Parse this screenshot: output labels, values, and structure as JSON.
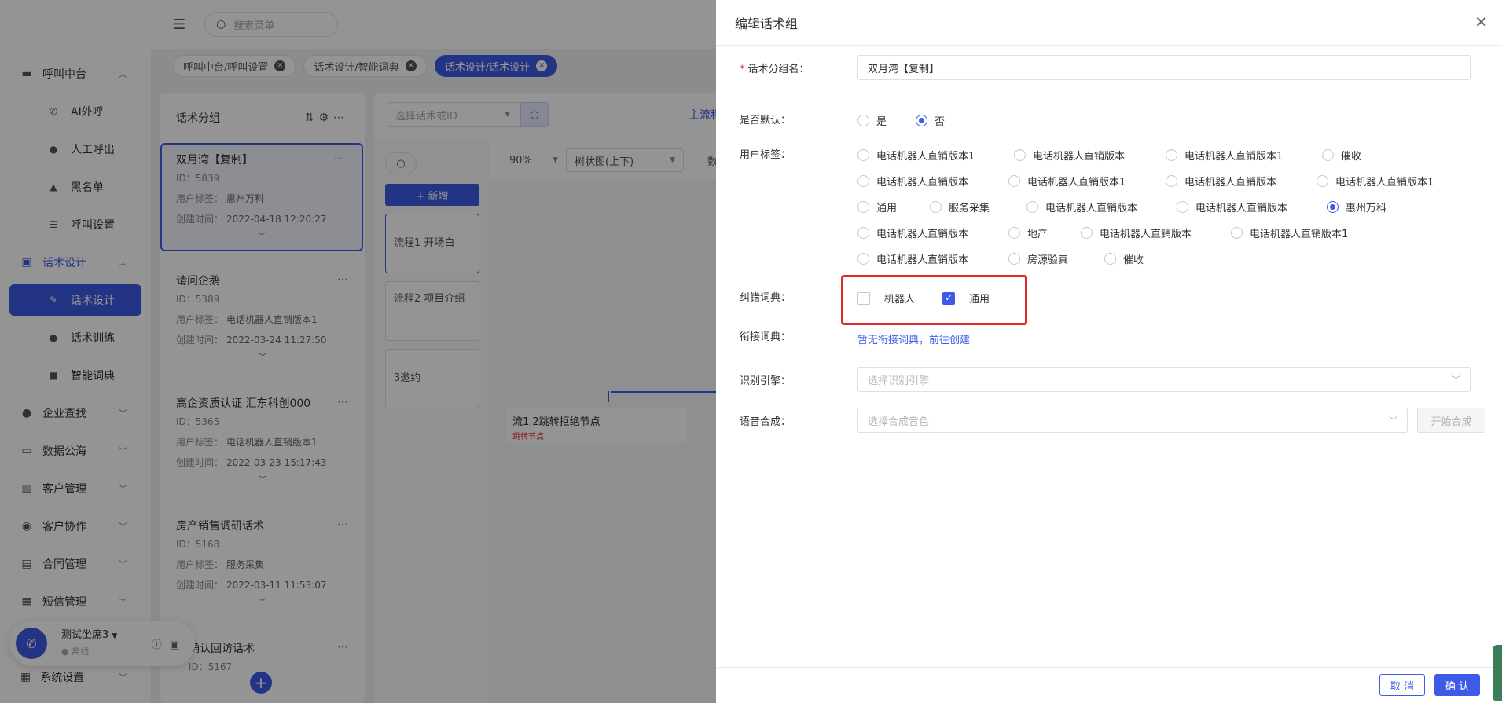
{
  "sidebar": {
    "groups": [
      {
        "label": "呼叫中台",
        "icon": "monitor-icon",
        "expanded": true,
        "items": [
          {
            "label": "AI外呼",
            "icon": "phone-icon"
          },
          {
            "label": "人工呼出",
            "icon": "user-icon"
          },
          {
            "label": "黑名单",
            "icon": "warning-icon"
          },
          {
            "label": "呼叫设置",
            "icon": "sliders-icon"
          }
        ]
      },
      {
        "label": "话术设计",
        "icon": "script-icon",
        "expanded": true,
        "active": true,
        "items": [
          {
            "label": "话术设计",
            "icon": "pen-icon",
            "active": true
          },
          {
            "label": "话术训练",
            "icon": "chat-icon"
          },
          {
            "label": "智能词典",
            "icon": "book-icon"
          }
        ]
      },
      {
        "label": "企业查找",
        "icon": "bulb-icon"
      },
      {
        "label": "数据公海",
        "icon": "chart-icon"
      },
      {
        "label": "客户管理",
        "icon": "customer-icon"
      },
      {
        "label": "客户协作",
        "icon": "collab-icon"
      },
      {
        "label": "合同管理",
        "icon": "clipboard-icon"
      },
      {
        "label": "短信管理",
        "icon": "sms-icon"
      }
    ],
    "system_settings": "系统设置"
  },
  "topbar": {
    "search_placeholder": "搜索菜单"
  },
  "tabs": [
    {
      "label": "呼叫中台/呼叫设置",
      "active": false
    },
    {
      "label": "话术设计/智能词典",
      "active": false
    },
    {
      "label": "话术设计/话术设计",
      "active": true
    }
  ],
  "group_panel": {
    "title": "话术分组",
    "tag_label": "用户标签：",
    "time_label": "创建时间：",
    "cards": [
      {
        "name": "双月湾【复制】",
        "id": "ID：5839",
        "tag": "惠州万科",
        "time": "2022-04-18 12:20:27",
        "selected": true
      },
      {
        "name": "请问企鹅",
        "id": "ID：5389",
        "tag": "电话机器人直销版本1",
        "time": "2022-03-24 11:27:50"
      },
      {
        "name": "高企资质认证 汇东科创000",
        "id": "ID：5365",
        "tag": "电话机器人直销版本1",
        "time": "2022-03-23 15:17:43"
      },
      {
        "name": "房产销售调研话术",
        "id": "ID：5168",
        "tag": "服务采集",
        "time": "2022-03-11 11:53:07"
      },
      {
        "name": "确认回访话术",
        "id": "ID：5167"
      }
    ]
  },
  "flow": {
    "search_placeholder": "选择话术或ID",
    "main_tab": "主流程",
    "new_button": "+ 新增",
    "items": [
      "流程1 开场白",
      "流程2 项目介绍",
      "3邀约"
    ],
    "zoom": "90%",
    "layout": "树状图(上下)",
    "toolbar_extra": "数",
    "node_title": "流1.2跳转拒绝节点",
    "node_sub": "跳转节点"
  },
  "call_widget": {
    "agent": "测试坐席3",
    "status": "离线"
  },
  "drawer": {
    "title": "编辑话术组",
    "fields": {
      "group_name": {
        "label": "话术分组名：",
        "value": "双月湾【复制】"
      },
      "is_default": {
        "label": "是否默认：",
        "options": [
          "是",
          "否"
        ],
        "selected": "否"
      },
      "user_tags": {
        "label": "用户标签：",
        "options": [
          "电话机器人直销版本1",
          "电话机器人直销版本",
          "电话机器人直销版本1",
          "催收",
          "电话机器人直销版本",
          "电话机器人直销版本1",
          "电话机器人直销版本",
          "电话机器人直销版本1",
          "通用",
          "服务采集",
          "电话机器人直销版本",
          "电话机器人直销版本",
          "惠州万科",
          "电话机器人直销版本",
          "地产",
          "电话机器人直销版本",
          "电话机器人直销版本1",
          "电话机器人直销版本",
          "房源验真",
          "催收"
        ],
        "selected": "惠州万科"
      },
      "correction_dict": {
        "label": "纠错词典：",
        "options": [
          "机器人",
          "通用"
        ],
        "checked": [
          "通用"
        ]
      },
      "link_dict": {
        "label": "衔接词典：",
        "link": "暂无衔接词典，前往创建"
      },
      "engine": {
        "label": "识别引擎：",
        "placeholder": "选择识别引擎"
      },
      "tts": {
        "label": "语音合成：",
        "placeholder": "选择合成音色",
        "button": "开始合成"
      }
    },
    "cancel": "取 消",
    "confirm": "确 认"
  },
  "colors": {
    "accent": "#3d5be6",
    "highlight": "#e52727"
  }
}
